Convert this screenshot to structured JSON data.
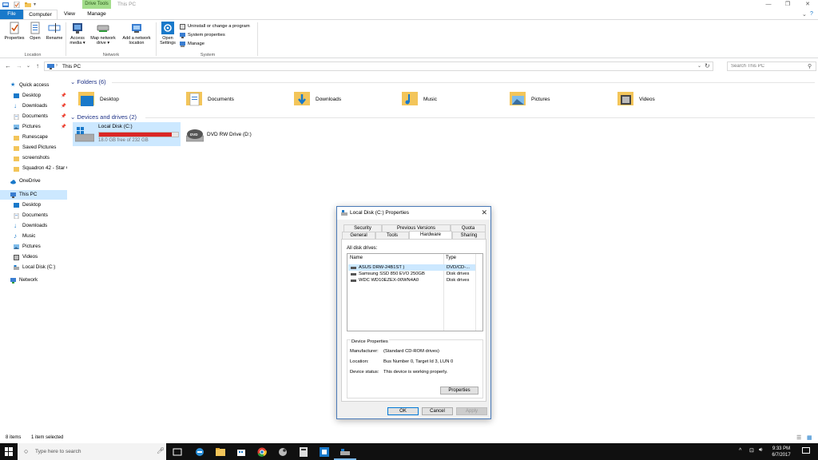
{
  "window": {
    "title": "This PC",
    "context_tab": "Drive Tools",
    "controls": {
      "minimize": "—",
      "maximize": "❐",
      "close": "✕",
      "help": "?"
    }
  },
  "ribbon_tabs": {
    "file": "File",
    "computer": "Computer",
    "view": "View",
    "manage": "Manage"
  },
  "ribbon": {
    "location": {
      "label": "Location",
      "buttons": [
        "Properties",
        "Open",
        "Rename"
      ]
    },
    "network": {
      "label": "Network",
      "access_media": [
        "Access",
        "media ▾"
      ],
      "map_network_drive": [
        "Map network",
        "drive ▾"
      ],
      "add_network_location": [
        "Add a network",
        "location"
      ]
    },
    "system": {
      "label": "System",
      "open_settings": [
        "Open",
        "Settings"
      ],
      "items": [
        "Uninstall or change a program",
        "System properties",
        "Manage"
      ]
    }
  },
  "address": {
    "path": "This PC",
    "search_placeholder": "Search This PC"
  },
  "sidebar": {
    "quick_access": "Quick access",
    "pinned": [
      "Desktop",
      "Downloads",
      "Documents",
      "Pictures"
    ],
    "recent": [
      "Runescape",
      "Saved Pictures",
      "screenshots",
      "Squadron 42 - Star C"
    ],
    "onedrive": "OneDrive",
    "this_pc": "This PC",
    "this_pc_items": [
      "Desktop",
      "Documents",
      "Downloads",
      "Music",
      "Pictures",
      "Videos",
      "Local Disk (C:)"
    ],
    "network": "Network"
  },
  "content": {
    "folders_header": "Folders (6)",
    "folders": [
      "Desktop",
      "Documents",
      "Downloads",
      "Music",
      "Pictures",
      "Videos"
    ],
    "drives_header": "Devices and drives (2)",
    "drive_c": {
      "name": "Local Disk (C:)",
      "free": "18.0 GB free of 232 GB",
      "used_fraction": 0.92,
      "bar_color": "#da2626"
    },
    "drive_d": {
      "name": "DVD RW Drive (D:)",
      "badge": "DVD"
    }
  },
  "status": {
    "items": "8 items",
    "selected": "1 item selected"
  },
  "dialog": {
    "title": "Local Disk (C:) Properties",
    "tabs_top": [
      "Security",
      "Previous Versions",
      "Quota"
    ],
    "tabs_bottom": [
      "General",
      "Tools",
      "Hardware",
      "Sharing"
    ],
    "all_disk_drives": "All disk drives:",
    "columns": [
      "Name",
      "Type"
    ],
    "rows": [
      {
        "name": "ASUS DRW-24B1ST   )",
        "type": "DVD/CD-..."
      },
      {
        "name": "Samsung SSD 850 EVO 250GB",
        "type": "Disk drives"
      },
      {
        "name": "WDC WD10EZEX-00WN4A0",
        "type": "Disk drives"
      }
    ],
    "device_properties": {
      "heading": "Device Properties",
      "manufacturer_label": "Manufacturer:",
      "manufacturer": "(Standard CD-ROM drives)",
      "location_label": "Location:",
      "location": "Bus Number 0, Target Id 3, LUN 0",
      "status_label": "Device status:",
      "status": "This device is working properly.",
      "properties_button": "Properties"
    },
    "ok": "OK",
    "cancel": "Cancel",
    "apply": "Apply"
  },
  "taskbar": {
    "search_placeholder": "Type here to search",
    "time": "9:33 PM",
    "date": "6/7/2017"
  },
  "colors": {
    "accent": "#1979ca",
    "selection": "#cce8ff",
    "section_header": "#1e3287",
    "drive_bar": "#da2626"
  }
}
